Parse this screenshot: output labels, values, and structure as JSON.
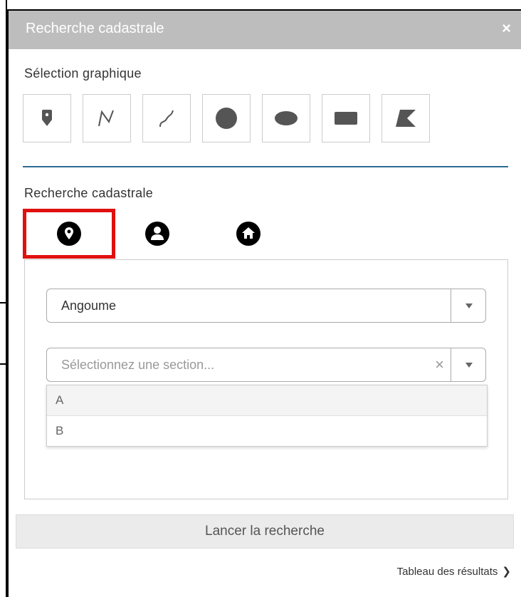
{
  "window": {
    "title": "Recherche cadastrale",
    "close_label": "×"
  },
  "graphic_selection": {
    "label": "Sélection graphique",
    "tools": [
      "point-icon",
      "polyline-icon",
      "freehand-line-icon",
      "circle-icon",
      "ellipse-icon",
      "rectangle-icon",
      "polygon-icon"
    ]
  },
  "cadastral_search": {
    "label": "Recherche cadastrale",
    "tabs": [
      "location-icon",
      "owner-icon",
      "address-icon"
    ],
    "active_tab": 0,
    "commune_select": {
      "value": "Angoume"
    },
    "section_select": {
      "placeholder": "Sélectionnez une section...",
      "clear_label": "×",
      "options": [
        "A",
        "B"
      ]
    }
  },
  "actions": {
    "search_button": "Lancer la recherche",
    "results_link": "Tableau des résultats",
    "results_chevron": "❯"
  },
  "colors": {
    "titlebar": "#bdbdbd",
    "divider": "#2e6b93",
    "highlight_border": "#e01010"
  }
}
